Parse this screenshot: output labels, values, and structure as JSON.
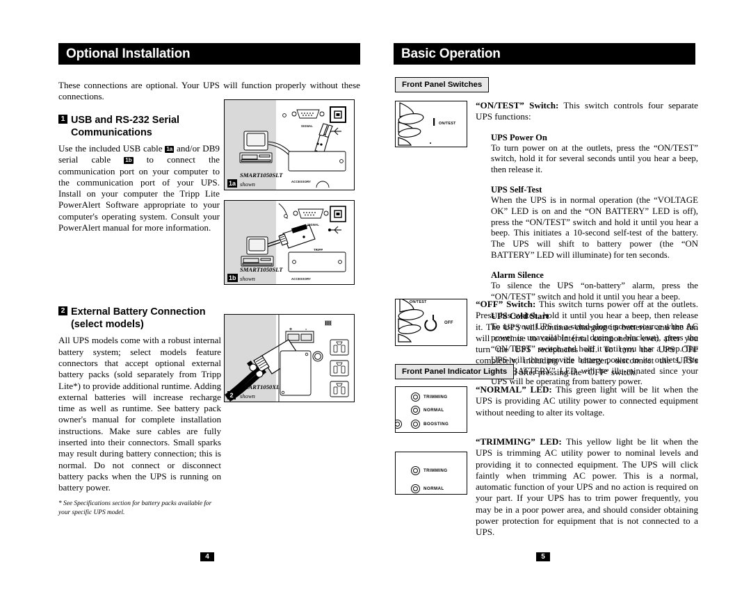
{
  "left_page": {
    "banner_title": "Optional Installation",
    "intro": "These connections are optional. Your UPS will function properly without these connections.",
    "sections": [
      {
        "number": "1",
        "title_line1": "USB and RS-232 Serial",
        "title_line2": "Communications",
        "body_pre": "Use the included USB cable",
        "tag_a": "1a",
        "body_mid": "and/or DB9 serial cable",
        "tag_b": "1b",
        "body_post": "to connect the communication port on your computer to the communication port of your UPS. Install on your computer the Tripp Lite PowerAlert Software appropriate to your computer's operating system. Consult your PowerAlert manual for more information."
      },
      {
        "number": "2",
        "title_line1": "External Battery Connection",
        "title_line2": "(select models)",
        "body": "All UPS models come with a robust internal battery system; select models feature connectors that accept optional external battery packs (sold separately from Tripp Lite*) to provide additional runtime. Adding external batteries will increase recharge time as well as runtime. See battery pack owner's manual for complete installation instructions. Make sure cables are fully inserted into their connectors. Small sparks may result during battery connection; this is normal. Do not connect or disconnect battery packs when the UPS is running on battery power.",
        "footnote": "* See Specifications section for battery packs available for your specific UPS model."
      }
    ],
    "figures": [
      {
        "label": "1a",
        "caption_model": "SMART1050SLT",
        "caption_shown": "shown",
        "port_labels": [
          "SIGNAL",
          "ACCESSORY"
        ]
      },
      {
        "label": "1b",
        "caption_model": "SMART1050SLT",
        "caption_shown": "shown",
        "port_labels": [
          "SIGNAL",
          "TRIPP",
          "ACCESSORY"
        ]
      },
      {
        "label": "2",
        "caption_model": "SMART1050XL",
        "caption_shown": "shown",
        "polarity": [
          "+",
          "-"
        ]
      }
    ],
    "page_number": "4"
  },
  "right_page": {
    "banner_title": "Basic Operation",
    "subhead_switches": "Front Panel Switches",
    "subhead_indicators": "Front Panel Indicator Lights",
    "on_test": {
      "lead_bold": "“ON/TEST” Switch:",
      "lead_rest": " This switch controls four separate UPS functions:",
      "items": [
        {
          "title": "UPS Power On",
          "body": "To turn power on at the outlets, press the “ON/TEST” switch, hold it for several seconds until you hear a beep, then release it."
        },
        {
          "title": "UPS Self-Test",
          "body": "When the UPS is in normal operation (the “VOLTAGE OK” LED is on and the “ON BATTERY” LED is off), press the “ON/TEST” switch and hold it until you hear a beep. This initiates a 10-second self-test of the battery. The UPS will shift to battery power (the “ON BATTERY” LED will illuminate) for ten seconds."
        },
        {
          "title": "Alarm Silence",
          "body": "To silence the UPS “on-battery” alarm, press the “ON/TEST” switch and hold it until you hear a beep."
        },
        {
          "title": "UPS Cold Start",
          "body": "To use your UPS as a stand-alone power source when AC power is unavailable (i.e. during a blackout), press the “ON/TEST” switch and hold it until you hear a beep. The UPS will then provide battery power to its outlets. The “ON BATTERY” LED will be illu-minated since your UPS will be operating from battery power."
        }
      ]
    },
    "off_switch": {
      "lead_bold": "“OFF” Switch:",
      "lead_rest": " This switch turns power off at the outlets. Press this switch, hold it until you hear a beep, then release it. The UPS will continue charging its batteries and the fan will continue to cool internal components even after you turn the UPS receptacles off. To turn the UPS OFF completely, including the charger, disconnect the UPS's power cord after pressing the “OFF” switch."
    },
    "normal_led": {
      "lead_bold": "“NORMAL” LED:",
      "lead_rest": " This green light will be lit when the UPS is providing AC utility power to connected equipment without needing to alter its voltage."
    },
    "trimming_led": {
      "lead_bold": "“TRIMMING” LED:",
      "lead_rest": " This yellow light be lit when the UPS is trimming AC utility power to nominal levels and providing it to connected equipment. The UPS will click faintly when trimming AC power. This is a normal, automatic function of your UPS and no action is required on your part. If your UPS has to trim power frequently, you may be in a poor power area, and should consider obtaining power protection for equipment that is not connected to a UPS."
    },
    "panel_figures": [
      {
        "name": "on-test-switch-panel",
        "switch_label": "ON/TEST"
      },
      {
        "name": "off-switch-panel",
        "top_label": "ON/TEST",
        "switch_label": "OFF"
      },
      {
        "name": "indicator-panel-normal",
        "leds": [
          "TRIMMING",
          "NORMAL",
          "BOOSTING"
        ]
      },
      {
        "name": "indicator-panel-trimming",
        "leds": [
          "TRIMMING",
          "NORMAL"
        ]
      }
    ],
    "page_number": "5"
  },
  "colors": {
    "banner_bg": "#000000",
    "banner_fg": "#ffffff",
    "subhead_bg": "#e8e8e8",
    "figure_shade": "#d9d9d9"
  }
}
